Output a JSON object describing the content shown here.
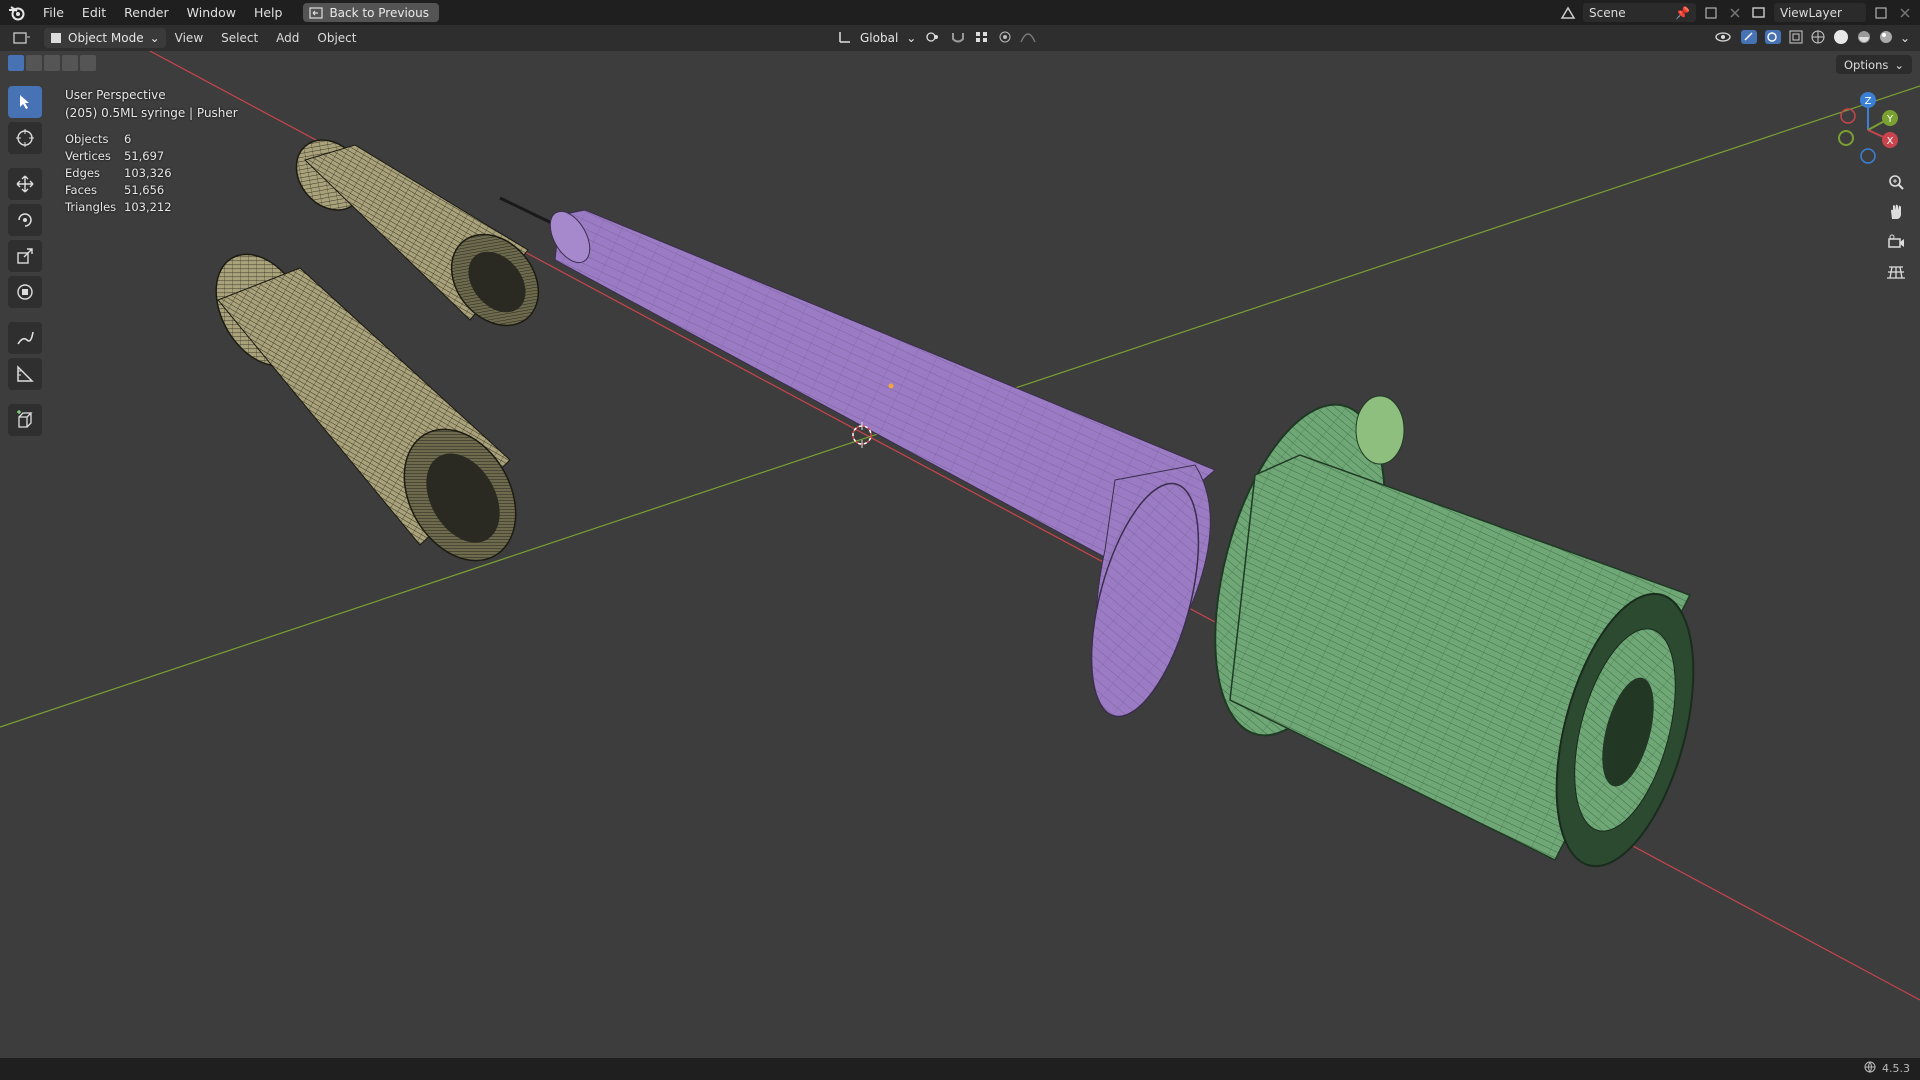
{
  "menu": {
    "file": "File",
    "edit": "Edit",
    "render": "Render",
    "window": "Window",
    "help": "Help",
    "back_button": "Back to Previous"
  },
  "scene": {
    "label": "Scene",
    "view_layer": "ViewLayer"
  },
  "header": {
    "mode": "Object Mode",
    "view": "View",
    "select": "Select",
    "add": "Add",
    "object": "Object",
    "orientation": "Global"
  },
  "viewport": {
    "perspective": "User Perspective",
    "active_object": "(205) 0.5ML syringe | Pusher",
    "options": "Options"
  },
  "stats": {
    "objects_label": "Objects",
    "objects": "6",
    "vertices_label": "Vertices",
    "vertices": "51,697",
    "edges_label": "Edges",
    "edges": "103,326",
    "faces_label": "Faces",
    "faces": "51,656",
    "triangles_label": "Triangles",
    "triangles": "103,212"
  },
  "gizmo": {
    "z": "Z",
    "y": "Y",
    "x": "X"
  },
  "status": {
    "version": "4.5.3"
  },
  "colors": {
    "background": "#3d3d3d",
    "x_axis": "#c9444d",
    "y_axis": "#7aa032",
    "barrel": "#9b7cc4",
    "plunger": "#6fa876",
    "cap": "#a9a27a",
    "active": "#4772b3"
  }
}
